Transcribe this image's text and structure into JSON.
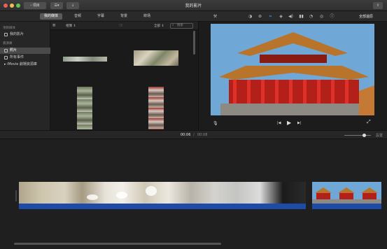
{
  "window": {
    "title": "我的影片",
    "back_label": "項目"
  },
  "toolbar": {
    "tabs": [
      {
        "label": "我的媒体",
        "active": true
      },
      {
        "label": "音频",
        "active": false
      },
      {
        "label": "字幕",
        "active": false
      },
      {
        "label": "背景",
        "active": false
      },
      {
        "label": "转场",
        "active": false
      }
    ],
    "reset_label": "全部還原"
  },
  "sidebar": {
    "section1_header": "項目媒体",
    "project_item": "我的影片",
    "section2_header": "資源庫",
    "library_items": [
      {
        "label": "照片",
        "selected": true
      },
      {
        "label": "所有事件",
        "selected": false
      }
    ],
    "imovie_library": "iMovie 劇場資源庫"
  },
  "browser": {
    "filter_label": "相簿",
    "all_label": "全部",
    "search_placeholder": "搜索"
  },
  "midbar": {
    "current_time": "00:06",
    "separator": "/",
    "total_time": "00:08",
    "settings_label": "設置"
  },
  "colors": {
    "accent_blue": "#1e4aa8",
    "sky": "#6fa8d6",
    "roof": "#b8742a",
    "wall": "#b3201a"
  }
}
